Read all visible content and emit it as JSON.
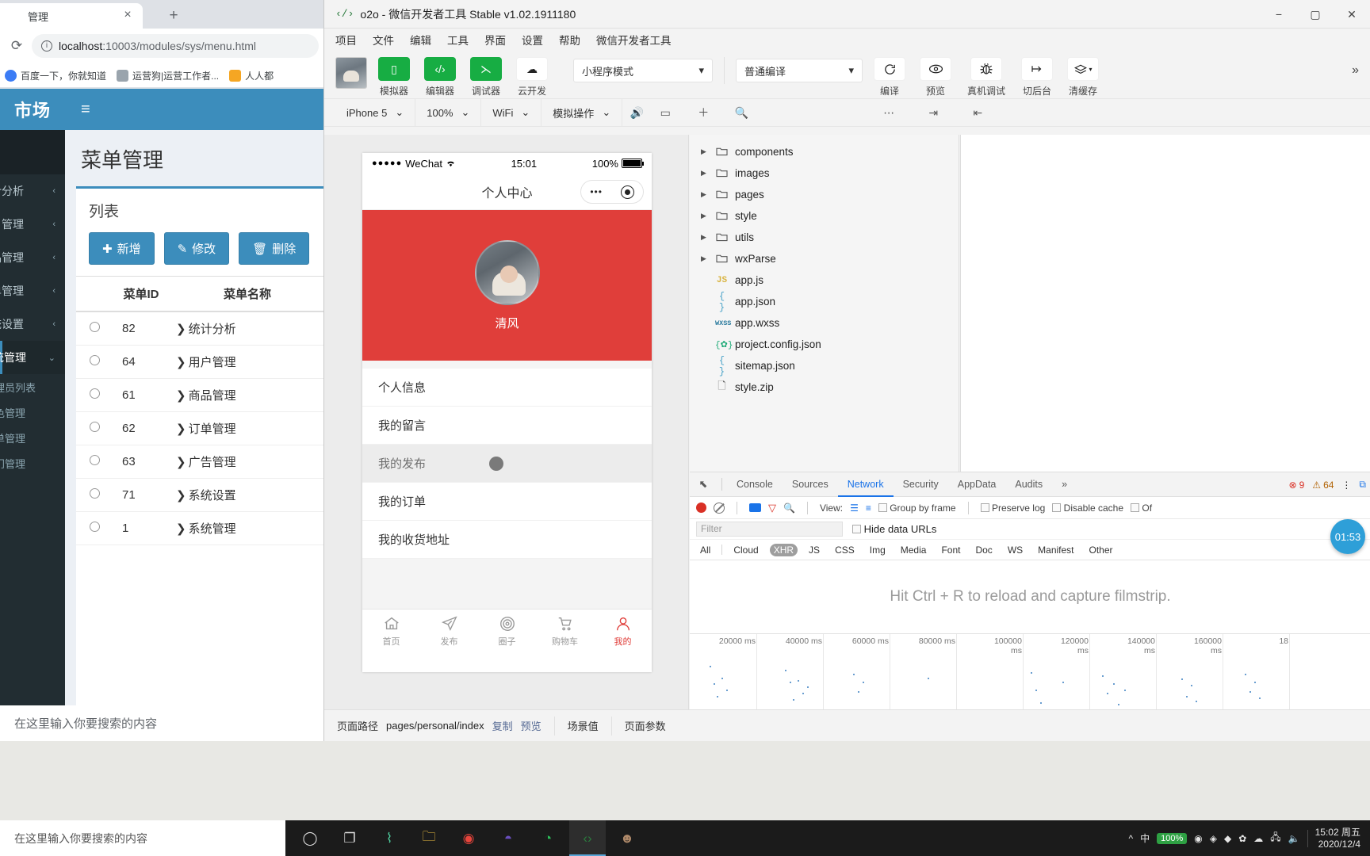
{
  "browser": {
    "tab_title": "管理",
    "close_icon": "×",
    "newtab_icon": "+",
    "reload_icon": "⟳",
    "url_prefix": "localhost",
    "url_rest": ":10003/modules/sys/menu.html",
    "info_icon": "i",
    "bookmarks": [
      {
        "label": "百度一下，你就知道"
      },
      {
        "label": "运营狗|运营工作者..."
      },
      {
        "label": "人人都"
      }
    ],
    "search_placeholder": "在这里输入你要搜索的内容"
  },
  "admin": {
    "brand": "市场",
    "burger_icon": "≡",
    "page_title": "菜单管理",
    "box_title": "列表",
    "buttons": [
      {
        "icon": "✚",
        "label": "新增"
      },
      {
        "icon": "✎",
        "label": "修改"
      },
      {
        "icon": "🗑",
        "label": "删除"
      }
    ],
    "sidebar": [
      {
        "label": "统计分析",
        "chev": "‹",
        "active": false
      },
      {
        "label": "用户管理",
        "chev": "‹",
        "active": false
      },
      {
        "label": "商品管理",
        "chev": "‹",
        "active": false
      },
      {
        "label": "订单管理",
        "chev": "‹",
        "active": false
      },
      {
        "label": "系统设置",
        "chev": "‹",
        "active": false
      },
      {
        "label": "系统管理",
        "chev": "⌄",
        "active": true
      }
    ],
    "sidebar_sub": [
      {
        "label": "管理员列表"
      },
      {
        "label": "角色管理"
      },
      {
        "label": "菜单管理"
      },
      {
        "label": "部门管理"
      }
    ],
    "table": {
      "columns": [
        "",
        "菜单ID",
        "菜单名称"
      ],
      "rows": [
        {
          "id": "82",
          "name": "统计分析"
        },
        {
          "id": "64",
          "name": "用户管理"
        },
        {
          "id": "61",
          "name": "商品管理"
        },
        {
          "id": "62",
          "name": "订单管理"
        },
        {
          "id": "63",
          "name": "广告管理"
        },
        {
          "id": "71",
          "name": "系统设置"
        },
        {
          "id": "1",
          "name": "系统管理"
        }
      ],
      "arrow": "❯"
    }
  },
  "devtools": {
    "title": "o2o - 微信开发者工具 Stable v1.02.1911180",
    "logo": "‹/›",
    "window_controls": {
      "minimize": "−",
      "maximize": "▢",
      "close": "✕"
    },
    "menubar": [
      "项目",
      "文件",
      "编辑",
      "工具",
      "界面",
      "设置",
      "帮助",
      "微信开发者工具"
    ],
    "toolbar": {
      "items": [
        {
          "icon": "▯",
          "label": "模拟器",
          "style": "green"
        },
        {
          "icon": "‹/›",
          "label": "编辑器",
          "style": "green"
        },
        {
          "icon": "⋋",
          "label": "调试器",
          "style": "green"
        },
        {
          "icon": "☁",
          "label": "云开发",
          "style": "white"
        }
      ],
      "mode_select": "小程序模式",
      "compile_select": "普通编译",
      "actions": [
        {
          "icon": "⟳",
          "label": "编译"
        },
        {
          "icon": "👁",
          "label": "预览"
        },
        {
          "icon": "🐞",
          "label": "真机调试"
        },
        {
          "icon": "↦",
          "label": "切后台"
        },
        {
          "icon": "▤",
          "label": "清缓存"
        }
      ],
      "more_icon": "»"
    },
    "devbar": {
      "device": "iPhone 5",
      "zoom": "100%",
      "network": "WiFi",
      "simulate": "模拟操作",
      "icons": [
        "🔊",
        "▭",
        "＋",
        "🔍",
        "⋯",
        "⇥",
        "⇤"
      ],
      "chevron": "⌄"
    },
    "filetree": [
      {
        "type": "folder",
        "name": "components",
        "icon": "🗀",
        "tri": "▶"
      },
      {
        "type": "folder",
        "name": "images",
        "icon": "🗀",
        "tri": "▶"
      },
      {
        "type": "folder",
        "name": "pages",
        "icon": "🗀",
        "tri": "▶"
      },
      {
        "type": "folder",
        "name": "style",
        "icon": "🗀",
        "tri": "▶"
      },
      {
        "type": "folder",
        "name": "utils",
        "icon": "🗀",
        "tri": "▶"
      },
      {
        "type": "folder",
        "name": "wxParse",
        "icon": "🗀",
        "tri": "▶"
      },
      {
        "type": "js",
        "name": "app.js",
        "icon": "JS",
        "tri": ""
      },
      {
        "type": "json",
        "name": "app.json",
        "icon": "{ }",
        "tri": ""
      },
      {
        "type": "wxss",
        "name": "app.wxss",
        "icon": "WXSS",
        "tri": ""
      },
      {
        "type": "cfg",
        "name": "project.config.json",
        "icon": "{✿}",
        "tri": ""
      },
      {
        "type": "json",
        "name": "sitemap.json",
        "icon": "{ }",
        "tri": ""
      },
      {
        "type": "zip",
        "name": "style.zip",
        "icon": "🗋",
        "tri": ""
      }
    ],
    "panel": {
      "inspect_icon": "⬉",
      "tabs": [
        "Console",
        "Sources",
        "Network",
        "Security",
        "AppData",
        "Audits"
      ],
      "active_tab": "Network",
      "more_icon": "»",
      "error_count": "9",
      "warn_count": "64",
      "kebab_icon": "⋮",
      "dock_icon": "⧉",
      "view_label": "View:",
      "group_by_frame": "Group by frame",
      "preserve_log": "Preserve log",
      "disable_cache": "Disable cache",
      "offline": "Of",
      "filter_placeholder": "Filter",
      "hide_data_urls": "Hide data URLs",
      "types": [
        "All",
        "Cloud",
        "XHR",
        "JS",
        "CSS",
        "Img",
        "Media",
        "Font",
        "Doc",
        "WS",
        "Manifest",
        "Other"
      ],
      "active_type": "XHR",
      "hint": "Hit Ctrl + R to reload and capture filmstrip.",
      "timeline_ticks": [
        "20000 ms",
        "40000 ms",
        "60000 ms",
        "80000 ms",
        "100000 ms",
        "120000 ms",
        "140000 ms",
        "160000 ms",
        "18"
      ]
    },
    "statusbar": {
      "path_label": "页面路径",
      "path_value": "pages/personal/index",
      "copy": "复制",
      "preview": "预览",
      "scene": "场景值",
      "params": "页面参数"
    },
    "timer_badge": "01:53"
  },
  "simulator": {
    "status": {
      "signal": "●●●●●",
      "carrier": "WeChat",
      "wifi": "≈",
      "time": "15:01",
      "battery": "100%"
    },
    "nav_title": "个人中心",
    "capsule": {
      "dots": "•••",
      "circle": "◉"
    },
    "user_name": "清风",
    "menu_items": [
      {
        "label": "个人信息",
        "highlight": false
      },
      {
        "label": "我的留言",
        "highlight": false
      },
      {
        "label": "我的发布",
        "highlight": true
      },
      {
        "label": "我的订单",
        "highlight": false
      },
      {
        "label": "我的收货地址",
        "highlight": false
      }
    ],
    "tabbar": [
      {
        "label": "首页",
        "icon": "home",
        "active": false
      },
      {
        "label": "发布",
        "icon": "send",
        "active": false
      },
      {
        "label": "圈子",
        "icon": "circle",
        "active": false
      },
      {
        "label": "购物车",
        "icon": "cart",
        "active": false
      },
      {
        "label": "我的",
        "icon": "user",
        "active": true
      }
    ]
  },
  "taskbar": {
    "search_placeholder": "在这里输入你要搜索的内容",
    "items": [
      {
        "name": "cortana",
        "icon": "◯"
      },
      {
        "name": "task-view",
        "icon": "❐"
      },
      {
        "name": "app-s",
        "icon": "⌇"
      },
      {
        "name": "file-explorer",
        "icon": "🗀"
      },
      {
        "name": "chrome",
        "icon": "◉"
      },
      {
        "name": "app-purple",
        "icon": "◓"
      },
      {
        "name": "wechat",
        "icon": "◔"
      },
      {
        "name": "devtools",
        "icon": "‹›"
      },
      {
        "name": "avatar",
        "icon": "☻"
      }
    ],
    "tray": {
      "ime": "中",
      "battery_pct": "100%",
      "chevron": "^",
      "icons": [
        "◉",
        "◈",
        "◆",
        "✿",
        "☁",
        "🖧",
        "🔈"
      ],
      "time": "15:02 周五",
      "date": "2020/12/4"
    }
  },
  "colors": {
    "admin_blue": "#3c8dbc",
    "sidebar_dark": "#222d32",
    "wechat_green": "#17ad43",
    "hero_red": "#e03e3a",
    "devtools_accent": "#1a73e8"
  }
}
